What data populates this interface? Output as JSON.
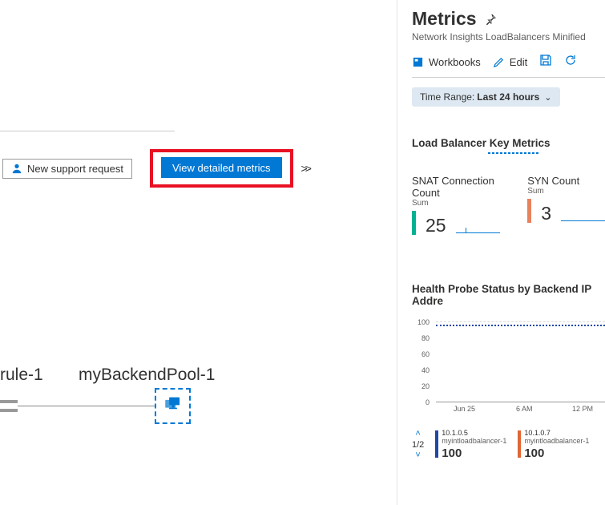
{
  "buttons": {
    "support": "New support request",
    "detailed": "View detailed metrics"
  },
  "topology": {
    "rule": "rule-1",
    "pool": "myBackendPool-1"
  },
  "panel": {
    "title": "Metrics",
    "subtitle": "Network Insights LoadBalancers Minified",
    "workbooks": "Workbooks",
    "edit": "Edit"
  },
  "time_range": {
    "label": "Time Range:",
    "value": "Last 24 hours"
  },
  "sections": {
    "key_metrics": "Load Balancer Key Metrics",
    "health": "Health Probe Status by Backend IP Addre"
  },
  "kpis": [
    {
      "title": "SNAT Connection Count",
      "agg": "Sum",
      "value": "25",
      "color": "#00b294"
    },
    {
      "title": "SYN Count",
      "agg": "Sum",
      "value": "3",
      "color": "#e8825d"
    }
  ],
  "chart_data": {
    "type": "line",
    "title": "Health Probe Status by Backend IP Address",
    "ylabel": "",
    "xlabel": "",
    "ylim": [
      0,
      100
    ],
    "y_ticks": [
      100,
      80,
      60,
      40,
      20,
      0
    ],
    "x_ticks": [
      "Jun 25",
      "6 AM",
      "12 PM"
    ],
    "series": [
      {
        "name": "myintloadbalancer-1",
        "ip": "10.1.0.5",
        "value": 100,
        "color": "#2147a6"
      },
      {
        "name": "myintloadbalancer-1",
        "ip": "10.1.0.7",
        "value": 100,
        "color": "#e06634"
      }
    ],
    "pager": "1/2"
  }
}
